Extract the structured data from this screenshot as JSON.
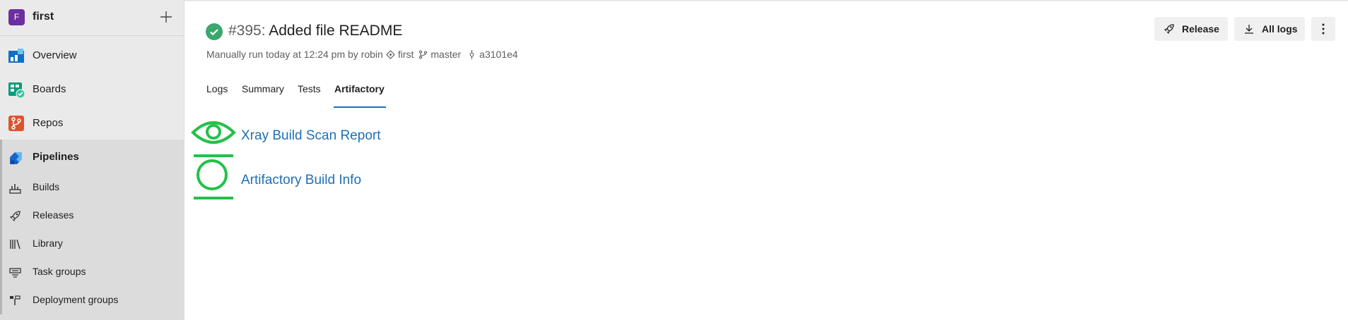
{
  "project": {
    "initial": "F",
    "name": "first"
  },
  "nav": {
    "overview": "Overview",
    "boards": "Boards",
    "repos": "Repos",
    "pipelines": "Pipelines",
    "sub": {
      "builds": "Builds",
      "releases": "Releases",
      "library": "Library",
      "task_groups": "Task groups",
      "deployment_groups": "Deployment groups"
    }
  },
  "run": {
    "status_icon": "success-check-icon",
    "number": "#395:",
    "title": "Added file README",
    "meta": {
      "prefix": "Manually run today at 12:24 pm by robin",
      "repo": "first",
      "branch": "master",
      "commit": "a3101e4"
    }
  },
  "actions": {
    "release": "Release",
    "all_logs": "All logs"
  },
  "tabs": [
    "Logs",
    "Summary",
    "Tests",
    "Artifactory"
  ],
  "active_tab": "Artifactory",
  "artifacts": [
    {
      "label": "Xray Build Scan Report",
      "icon": "eye-icon"
    },
    {
      "label": "Artifactory Build Info",
      "icon": "circle-icon"
    }
  ],
  "colors": {
    "accent": "#0078d4",
    "link": "#1f6fb4",
    "success": "#3aa76d",
    "artifact_green": "#24c04a"
  }
}
